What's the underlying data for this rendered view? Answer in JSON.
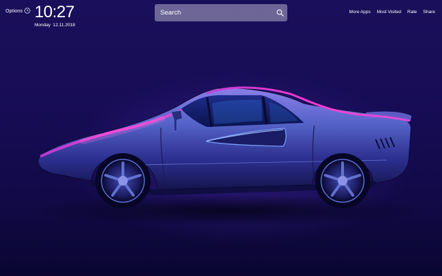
{
  "header": {
    "options_label": "Options",
    "clock_icon": "clock-icon",
    "time": "10:27",
    "date": "Monday  12.11.2018"
  },
  "search": {
    "placeholder": "Search",
    "icon": "search-icon"
  },
  "nav_links": [
    {
      "label": "More Apps"
    },
    {
      "label": "Most Visited"
    },
    {
      "label": "Rate"
    },
    {
      "label": "Share"
    }
  ],
  "wallpaper": {
    "subject": "car-wallpaper",
    "colors": {
      "background_top": "#1a0f5a",
      "background_bottom": "#0a0631",
      "car_body": "#5a6fd0",
      "neon_highlight": "#ff3cd2",
      "window_glow": "#3a8cff"
    }
  }
}
